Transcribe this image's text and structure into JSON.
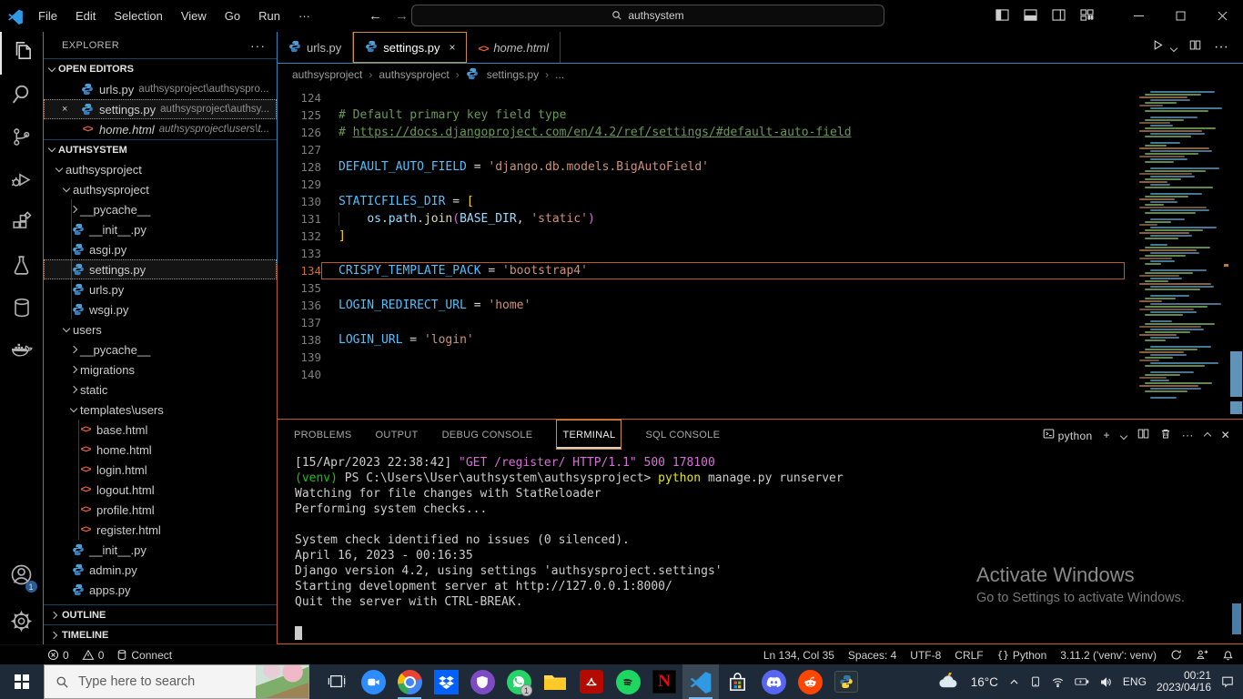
{
  "titlebar": {
    "menus": [
      "File",
      "Edit",
      "Selection",
      "View",
      "Go",
      "Run",
      "···"
    ],
    "search_value": "authsystem"
  },
  "activity_bar": {
    "top": [
      {
        "name": "explorer",
        "active": true
      },
      {
        "name": "search"
      },
      {
        "name": "source-control"
      },
      {
        "name": "run-debug"
      },
      {
        "name": "extensions"
      },
      {
        "name": "testing"
      },
      {
        "name": "database"
      },
      {
        "name": "docker"
      }
    ],
    "bottom": [
      {
        "name": "accounts",
        "badge": "1"
      },
      {
        "name": "settings"
      }
    ]
  },
  "sidebar": {
    "title": "EXPLORER",
    "open_editors": {
      "label": "OPEN EDITORS",
      "items": [
        {
          "icon": "py",
          "label": "urls.py",
          "path": "authsysproject\\authsyspro..."
        },
        {
          "icon": "py",
          "label": "settings.py",
          "path": "authsysproject\\authsy...",
          "active": true,
          "close": true
        },
        {
          "icon": "html",
          "label": "home.html",
          "path": "authsysproject\\users\\t...",
          "italic": true
        }
      ]
    },
    "tree": {
      "root": "AUTHSYSTEM",
      "items": [
        {
          "level": 1,
          "chev": "down",
          "label": "authsysproject"
        },
        {
          "level": 2,
          "chev": "down",
          "label": "authsysproject"
        },
        {
          "level": 3,
          "chev": "right",
          "label": "__pycache__"
        },
        {
          "level": 3,
          "icon": "py",
          "label": "__init__.py"
        },
        {
          "level": 3,
          "icon": "py",
          "label": "asgi.py"
        },
        {
          "level": 3,
          "icon": "py",
          "label": "settings.py",
          "selected": true
        },
        {
          "level": 3,
          "icon": "py",
          "label": "urls.py"
        },
        {
          "level": 3,
          "icon": "py",
          "label": "wsgi.py"
        },
        {
          "level": 2,
          "chev": "down",
          "label": "users"
        },
        {
          "level": 3,
          "chev": "right",
          "label": "__pycache__"
        },
        {
          "level": 3,
          "chev": "right",
          "label": "migrations"
        },
        {
          "level": 3,
          "chev": "right",
          "label": "static"
        },
        {
          "level": 3,
          "chev": "down",
          "label": "templates\\users"
        },
        {
          "level": 4,
          "icon": "html",
          "label": "base.html"
        },
        {
          "level": 4,
          "icon": "html",
          "label": "home.html"
        },
        {
          "level": 4,
          "icon": "html",
          "label": "login.html"
        },
        {
          "level": 4,
          "icon": "html",
          "label": "logout.html"
        },
        {
          "level": 4,
          "icon": "html",
          "label": "profile.html"
        },
        {
          "level": 4,
          "icon": "html",
          "label": "register.html"
        },
        {
          "level": 3,
          "icon": "py",
          "label": "__init__.py"
        },
        {
          "level": 3,
          "icon": "py",
          "label": "admin.py"
        },
        {
          "level": 3,
          "icon": "py",
          "label": "apps.py"
        }
      ]
    },
    "outline": "OUTLINE",
    "timeline": "TIMELINE"
  },
  "editor": {
    "tabs": [
      {
        "icon": "py",
        "label": "urls.py"
      },
      {
        "icon": "py",
        "label": "settings.py",
        "active": true,
        "close": true
      },
      {
        "icon": "html",
        "label": "home.html",
        "italic": true
      }
    ],
    "breadcrumb": [
      {
        "label": "authsysproject"
      },
      {
        "label": "authsysproject"
      },
      {
        "label": "settings.py",
        "icon": "py"
      },
      {
        "label": "..."
      }
    ],
    "code": {
      "current_line": 134,
      "lines": [
        {
          "n": 124,
          "t": []
        },
        {
          "n": 125,
          "t": [
            [
              "com",
              "# Default primary key field type"
            ]
          ]
        },
        {
          "n": 126,
          "t": [
            [
              "com",
              "# "
            ],
            [
              "link",
              "https://docs.djangoproject.com/en/4.2/ref/settings/#default-auto-field"
            ]
          ]
        },
        {
          "n": 127,
          "t": []
        },
        {
          "n": 128,
          "t": [
            [
              "var",
              "DEFAULT_AUTO_FIELD"
            ],
            [
              "op",
              " = "
            ],
            [
              "str",
              "'django.db.models.BigAutoField'"
            ]
          ]
        },
        {
          "n": 129,
          "t": []
        },
        {
          "n": 130,
          "t": [
            [
              "var",
              "STATICFILES_DIR"
            ],
            [
              "op",
              " = "
            ],
            [
              "br",
              "["
            ]
          ]
        },
        {
          "n": 131,
          "t": [
            [
              "gd",
              "    "
            ],
            [
              "prop",
              "os"
            ],
            [
              "op",
              "."
            ],
            [
              "prop",
              "path"
            ],
            [
              "op",
              "."
            ],
            [
              "fn",
              "join"
            ],
            [
              "par",
              "("
            ],
            [
              "prop",
              "BASE_DIR"
            ],
            [
              "op",
              ", "
            ],
            [
              "str",
              "'static'"
            ],
            [
              "par",
              ")"
            ]
          ]
        },
        {
          "n": 132,
          "t": [
            [
              "br",
              "]"
            ]
          ]
        },
        {
          "n": 133,
          "t": []
        },
        {
          "n": 134,
          "t": [
            [
              "var",
              "CRISPY_TEMPLATE_PACK"
            ],
            [
              "op",
              " = "
            ],
            [
              "str",
              "'bootstrap4'"
            ]
          ]
        },
        {
          "n": 135,
          "t": []
        },
        {
          "n": 136,
          "t": [
            [
              "var",
              "LOGIN_REDIRECT_URL"
            ],
            [
              "op",
              " = "
            ],
            [
              "str",
              "'home'"
            ]
          ]
        },
        {
          "n": 137,
          "t": []
        },
        {
          "n": 138,
          "t": [
            [
              "var",
              "LOGIN_URL"
            ],
            [
              "op",
              " = "
            ],
            [
              "str",
              "'login'"
            ]
          ]
        },
        {
          "n": 139,
          "t": []
        },
        {
          "n": 140,
          "t": []
        }
      ]
    }
  },
  "panel": {
    "tabs": [
      {
        "label": "PROBLEMS"
      },
      {
        "label": "OUTPUT"
      },
      {
        "label": "DEBUG CONSOLE"
      },
      {
        "label": "TERMINAL",
        "active": true
      },
      {
        "label": "SQL CONSOLE"
      }
    ],
    "shell_label": "python",
    "terminal_lines": [
      [
        [
          "w",
          "[15/Apr/2023 22:38:42] "
        ],
        [
          "m",
          "\"GET /register/ HTTP/1.1\" 500 178100"
        ]
      ],
      [
        [
          "g",
          "(venv)"
        ],
        [
          "w",
          " PS C:\\Users\\User\\authsystem\\authsysproject> "
        ],
        [
          "y",
          "python"
        ],
        [
          "w",
          " manage.py runserver"
        ]
      ],
      [
        [
          "w",
          "Watching for file changes with StatReloader"
        ]
      ],
      [
        [
          "w",
          "Performing system checks..."
        ]
      ],
      [],
      [
        [
          "w",
          "System check identified no issues (0 silenced)."
        ]
      ],
      [
        [
          "w",
          "April 16, 2023 - 00:16:35"
        ]
      ],
      [
        [
          "w",
          "Django version 4.2, using settings 'authsysproject.settings'"
        ]
      ],
      [
        [
          "w",
          "Starting development server at http://127.0.0.1:8000/"
        ]
      ],
      [
        [
          "w",
          "Quit the server with CTRL-BREAK."
        ]
      ],
      [],
      [
        [
          "cursor",
          ""
        ]
      ]
    ]
  },
  "statusbar": {
    "left": [
      {
        "icon": "error",
        "text": "0"
      },
      {
        "icon": "warning",
        "text": "0"
      },
      {
        "icon": "db",
        "text": "Connect"
      }
    ],
    "right": [
      {
        "text": "Ln 134, Col 35"
      },
      {
        "text": "Spaces: 4"
      },
      {
        "text": "UTF-8"
      },
      {
        "text": "CRLF"
      },
      {
        "icon": "braces",
        "text": "Python"
      },
      {
        "text": "3.11.2 ('venv': venv)"
      },
      {
        "icon": "sync"
      },
      {
        "icon": "feedback"
      },
      {
        "icon": "bell"
      }
    ]
  },
  "watermark": {
    "title": "Activate Windows",
    "subtitle": "Go to Settings to activate Windows."
  },
  "taskbar": {
    "search_placeholder": "Type here to search",
    "apps": [
      {
        "name": "task-view"
      },
      {
        "name": "zoom"
      },
      {
        "name": "chrome",
        "running": true
      },
      {
        "name": "dropbox"
      },
      {
        "name": "shield"
      },
      {
        "name": "whatsapp",
        "badge": "1"
      },
      {
        "name": "file-explorer"
      },
      {
        "name": "acrobat"
      },
      {
        "name": "spotify"
      },
      {
        "name": "netflix"
      },
      {
        "name": "vscode",
        "active": true,
        "running": true
      },
      {
        "name": "store"
      },
      {
        "name": "discord"
      },
      {
        "name": "reddit"
      },
      {
        "name": "python-console"
      }
    ],
    "tray": {
      "temp": "16°C",
      "icons": [
        "chevron-up",
        "phone",
        "wifi",
        "battery",
        "volume"
      ],
      "lang": "ENG",
      "time": "00:21",
      "date": "2023/04/16"
    }
  },
  "colors": {
    "accent_orange": "#bf5a22",
    "accent_blue_border": "#2b86ba",
    "taskbar_indicator": "#76b9ed"
  }
}
